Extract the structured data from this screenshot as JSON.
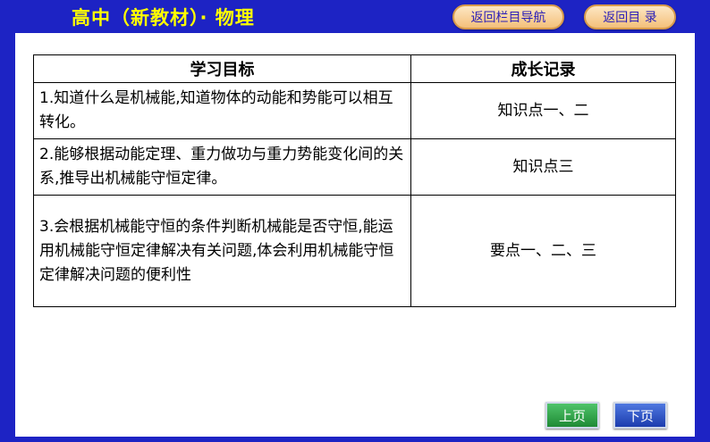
{
  "header": {
    "title": "高中（新教材）· 物理",
    "nav_back_column": "返回栏目导航",
    "nav_back_toc": "返回目 录"
  },
  "table": {
    "columns": [
      "学习目标",
      "成长记录"
    ],
    "rows": [
      {
        "goal": "1.知道什么是机械能,知道物体的动能和势能可以相互转化。",
        "record": "知识点一、二"
      },
      {
        "goal": "2.能够根据动能定理、重力做功与重力势能变化间的关系,推导出机械能守恒定律。",
        "record": "知识点三"
      },
      {
        "goal": "3.会根据机械能守恒的条件判断机械能是否守恒,能运用机械能守恒定律解决有关问题,体会利用机械能守恒定律解决问题的便利性",
        "record": "要点一、二、三"
      }
    ]
  },
  "pager": {
    "prev_label": "上页",
    "next_label": "下页"
  },
  "colors": {
    "background": "#1d23c4",
    "title": "#ffff00",
    "nav_button": "#f4c07a",
    "prev_button": "#2aa040",
    "next_button": "#2a4cc0"
  }
}
